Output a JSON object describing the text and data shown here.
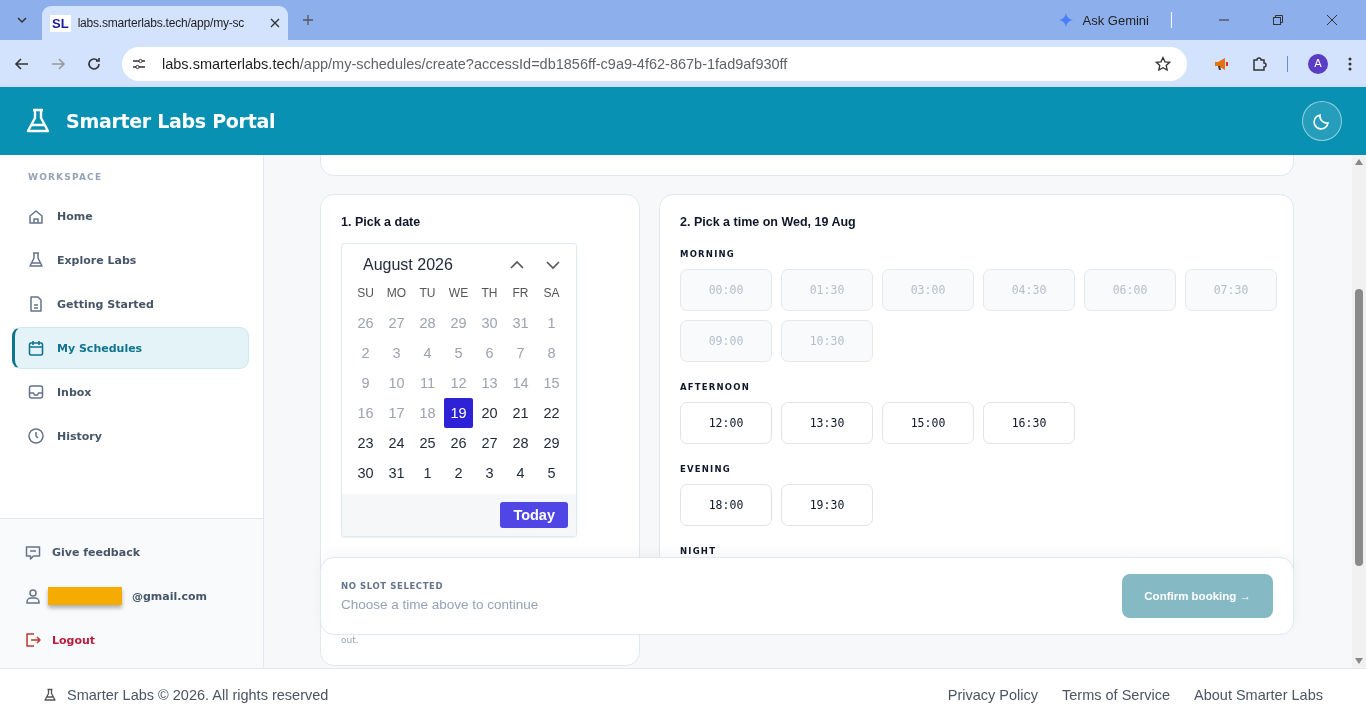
{
  "browser": {
    "tab_icon": "SL",
    "tab_title": "labs.smarterlabs.tech/app/my-sc",
    "url_host": "labs.smarterlabs.tech",
    "url_path": "/app/my-schedules/create?accessId=db1856ff-c9a9-4f62-867b-1fad9af930ff",
    "gemini": "Ask Gemini",
    "profile": "A"
  },
  "app": {
    "title": "Smarter Labs Portal"
  },
  "sidebar": {
    "section": "WORKSPACE",
    "items": [
      {
        "label": "Home",
        "kind": "home",
        "selected": false
      },
      {
        "label": "Explore Labs",
        "kind": "flask",
        "selected": false
      },
      {
        "label": "Getting Started",
        "kind": "doc",
        "selected": false
      },
      {
        "label": "My Schedules",
        "kind": "calendar",
        "selected": true
      },
      {
        "label": "Inbox",
        "kind": "inbox",
        "selected": false
      },
      {
        "label": "History",
        "kind": "clock",
        "selected": false
      }
    ],
    "footer_items": [
      {
        "label": "Give feedback",
        "kind": "feedback"
      },
      {
        "label": "@gmail.com",
        "kind": "account"
      },
      {
        "label": "Logout",
        "kind": "logout"
      }
    ]
  },
  "date_card": {
    "title": "1. Pick a date",
    "month": "August 2026",
    "weekdays": [
      "SU",
      "MO",
      "TU",
      "WE",
      "TH",
      "FR",
      "SA"
    ],
    "days": [
      {
        "label": "26",
        "muted": true,
        "selected": false
      },
      {
        "label": "27",
        "muted": true,
        "selected": false
      },
      {
        "label": "28",
        "muted": true,
        "selected": false
      },
      {
        "label": "29",
        "muted": true,
        "selected": false
      },
      {
        "label": "30",
        "muted": true,
        "selected": false
      },
      {
        "label": "31",
        "muted": true,
        "selected": false
      },
      {
        "label": "1",
        "muted": true,
        "selected": false
      },
      {
        "label": "2",
        "muted": true,
        "selected": false
      },
      {
        "label": "3",
        "muted": true,
        "selected": false
      },
      {
        "label": "4",
        "muted": true,
        "selected": false
      },
      {
        "label": "5",
        "muted": true,
        "selected": false
      },
      {
        "label": "6",
        "muted": true,
        "selected": false
      },
      {
        "label": "7",
        "muted": true,
        "selected": false
      },
      {
        "label": "8",
        "muted": true,
        "selected": false
      },
      {
        "label": "9",
        "muted": true,
        "selected": false
      },
      {
        "label": "10",
        "muted": true,
        "selected": false
      },
      {
        "label": "11",
        "muted": true,
        "selected": false
      },
      {
        "label": "12",
        "muted": true,
        "selected": false
      },
      {
        "label": "13",
        "muted": true,
        "selected": false
      },
      {
        "label": "14",
        "muted": true,
        "selected": false
      },
      {
        "label": "15",
        "muted": true,
        "selected": false
      },
      {
        "label": "16",
        "muted": true,
        "selected": false
      },
      {
        "label": "17",
        "muted": true,
        "selected": false
      },
      {
        "label": "18",
        "muted": true,
        "selected": false
      },
      {
        "label": "19",
        "muted": false,
        "selected": true
      },
      {
        "label": "20",
        "muted": false,
        "selected": false
      },
      {
        "label": "21",
        "muted": false,
        "selected": false
      },
      {
        "label": "22",
        "muted": false,
        "selected": false
      },
      {
        "label": "23",
        "muted": false,
        "selected": false
      },
      {
        "label": "24",
        "muted": false,
        "selected": false
      },
      {
        "label": "25",
        "muted": false,
        "selected": false
      },
      {
        "label": "26",
        "muted": false,
        "selected": false
      },
      {
        "label": "27",
        "muted": false,
        "selected": false
      },
      {
        "label": "28",
        "muted": false,
        "selected": false
      },
      {
        "label": "29",
        "muted": false,
        "selected": false
      },
      {
        "label": "30",
        "muted": false,
        "selected": false
      },
      {
        "label": "31",
        "muted": false,
        "selected": false
      },
      {
        "label": "1",
        "muted": false,
        "selected": false
      },
      {
        "label": "2",
        "muted": false,
        "selected": false
      },
      {
        "label": "3",
        "muted": false,
        "selected": false
      },
      {
        "label": "4",
        "muted": false,
        "selected": false
      },
      {
        "label": "5",
        "muted": false,
        "selected": false
      }
    ],
    "today_button": "Today",
    "note": "out."
  },
  "time_card": {
    "title": "2. Pick a time on Wed, 19 Aug",
    "groups": [
      {
        "label": "MORNING",
        "slots": [
          {
            "time": "00:00",
            "disabled": true
          },
          {
            "time": "01:30",
            "disabled": true
          },
          {
            "time": "03:00",
            "disabled": true
          },
          {
            "time": "04:30",
            "disabled": true
          },
          {
            "time": "06:00",
            "disabled": true
          },
          {
            "time": "07:30",
            "disabled": true
          },
          {
            "time": "09:00",
            "disabled": true
          },
          {
            "time": "10:30",
            "disabled": true
          }
        ]
      },
      {
        "label": "AFTERNOON",
        "slots": [
          {
            "time": "12:00",
            "disabled": false
          },
          {
            "time": "13:30",
            "disabled": false
          },
          {
            "time": "15:00",
            "disabled": false
          },
          {
            "time": "16:30",
            "disabled": false
          }
        ]
      },
      {
        "label": "EVENING",
        "slots": [
          {
            "time": "18:00",
            "disabled": false
          },
          {
            "time": "19:30",
            "disabled": false
          }
        ]
      },
      {
        "label": "NIGHT"
      }
    ]
  },
  "booking_bar": {
    "status": "NO SLOT SELECTED",
    "hint": "Choose a time above to continue",
    "confirm": "Confirm booking →",
    "confirm_disabled": true
  },
  "footer": {
    "copyright": "Smarter Labs © 2026. All rights reserved",
    "links": [
      "Privacy Policy",
      "Terms of Service",
      "About Smarter Labs"
    ]
  }
}
